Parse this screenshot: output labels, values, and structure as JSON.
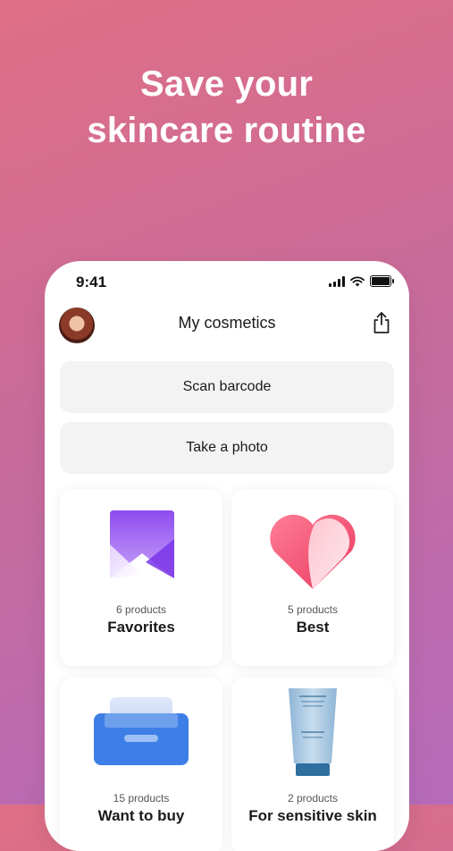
{
  "headline": {
    "line1": "Save your",
    "line2": "skincare routine"
  },
  "status_bar": {
    "time": "9:41"
  },
  "navbar": {
    "title": "My cosmetics"
  },
  "actions": {
    "scan": "Scan barcode",
    "photo": "Take a photo"
  },
  "collections": [
    {
      "count": "6 products",
      "name": "Favorites",
      "icon": "bookmark-icon"
    },
    {
      "count": "5 products",
      "name": "Best",
      "icon": "heart-icon"
    },
    {
      "count": "15 products",
      "name": "Want to buy",
      "icon": "tray-icon"
    },
    {
      "count": "2 products",
      "name": "For sensitive skin",
      "icon": "cream-tube-icon"
    }
  ],
  "colors": {
    "accent_purple": "#8a4de8",
    "heart_pink": "#f0587a",
    "tray_blue": "#3d7fe6"
  }
}
